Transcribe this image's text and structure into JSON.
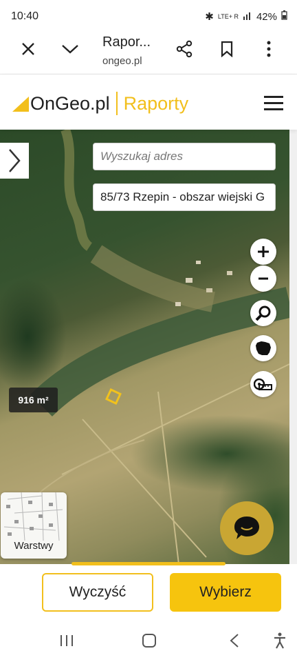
{
  "status_bar": {
    "time": "10:40",
    "network": "LTE+ R",
    "battery": "42%"
  },
  "browser": {
    "tab_title": "Rapor...",
    "url": "ongeo.pl"
  },
  "site": {
    "logo": "OnGeo.pl",
    "section": "Raporty"
  },
  "map": {
    "search_placeholder": "Wyszukaj adres",
    "parcel_value": "85/73 Rzepin - obszar wiejski G",
    "area_label": "916 m²",
    "layers_label": "Warstwy"
  },
  "actions": {
    "clear_label": "Wyczyść",
    "select_label": "Wybierz"
  },
  "colors": {
    "brand_yellow": "#f2bf1c",
    "button_yellow": "#f6c40e",
    "chat_button": "#c9a633"
  }
}
